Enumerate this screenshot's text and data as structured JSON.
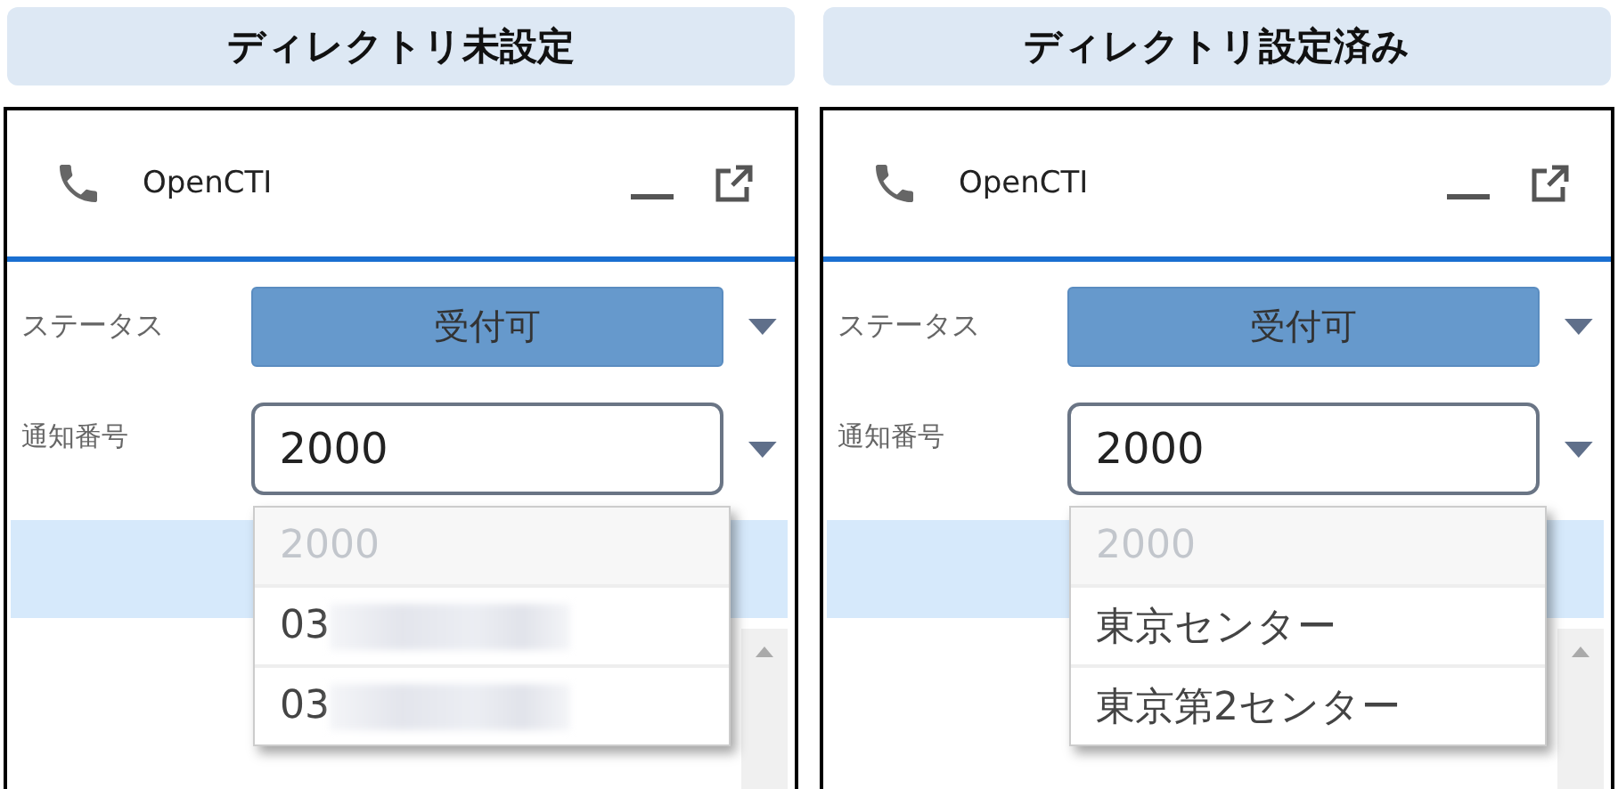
{
  "panels": [
    {
      "heading": "ディレクトリ未設定",
      "widget": {
        "title": "OpenCTI",
        "status": {
          "label": "ステータス",
          "value": "受付可"
        },
        "number": {
          "label": "通知番号",
          "value": "2000"
        },
        "options": [
          {
            "text": "2000",
            "disabled": true,
            "redacted": false
          },
          {
            "text": "03",
            "disabled": false,
            "redacted": true
          },
          {
            "text": "03",
            "disabled": false,
            "redacted": true
          }
        ]
      }
    },
    {
      "heading": "ディレクトリ設定済み",
      "widget": {
        "title": "OpenCTI",
        "status": {
          "label": "ステータス",
          "value": "受付可"
        },
        "number": {
          "label": "通知番号",
          "value": "2000"
        },
        "options": [
          {
            "text": "2000",
            "disabled": true,
            "redacted": false
          },
          {
            "text": "東京センター",
            "disabled": false,
            "redacted": false
          },
          {
            "text": "東京第2センター",
            "disabled": false,
            "redacted": false
          }
        ]
      }
    }
  ]
}
